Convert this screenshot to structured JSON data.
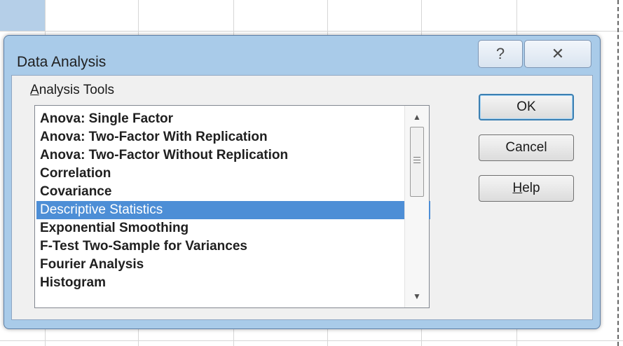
{
  "dialog": {
    "title": "Data Analysis",
    "help_glyph": "?",
    "close_glyph": "✕"
  },
  "analysis_tools": {
    "label_underlined": "A",
    "label_rest": "nalysis Tools",
    "items": [
      "Anova: Single Factor",
      "Anova: Two-Factor With Replication",
      "Anova: Two-Factor Without Replication",
      "Correlation",
      "Covariance",
      "Descriptive Statistics",
      "Exponential Smoothing",
      "F-Test Two-Sample for Variances",
      "Fourier Analysis",
      "Histogram"
    ],
    "selected": "Descriptive Statistics"
  },
  "buttons": {
    "ok": "OK",
    "cancel": "Cancel",
    "help_underlined": "H",
    "help_rest": "elp"
  },
  "colors": {
    "selection": "#4d8ed6",
    "frame": "#a9cbe9"
  }
}
